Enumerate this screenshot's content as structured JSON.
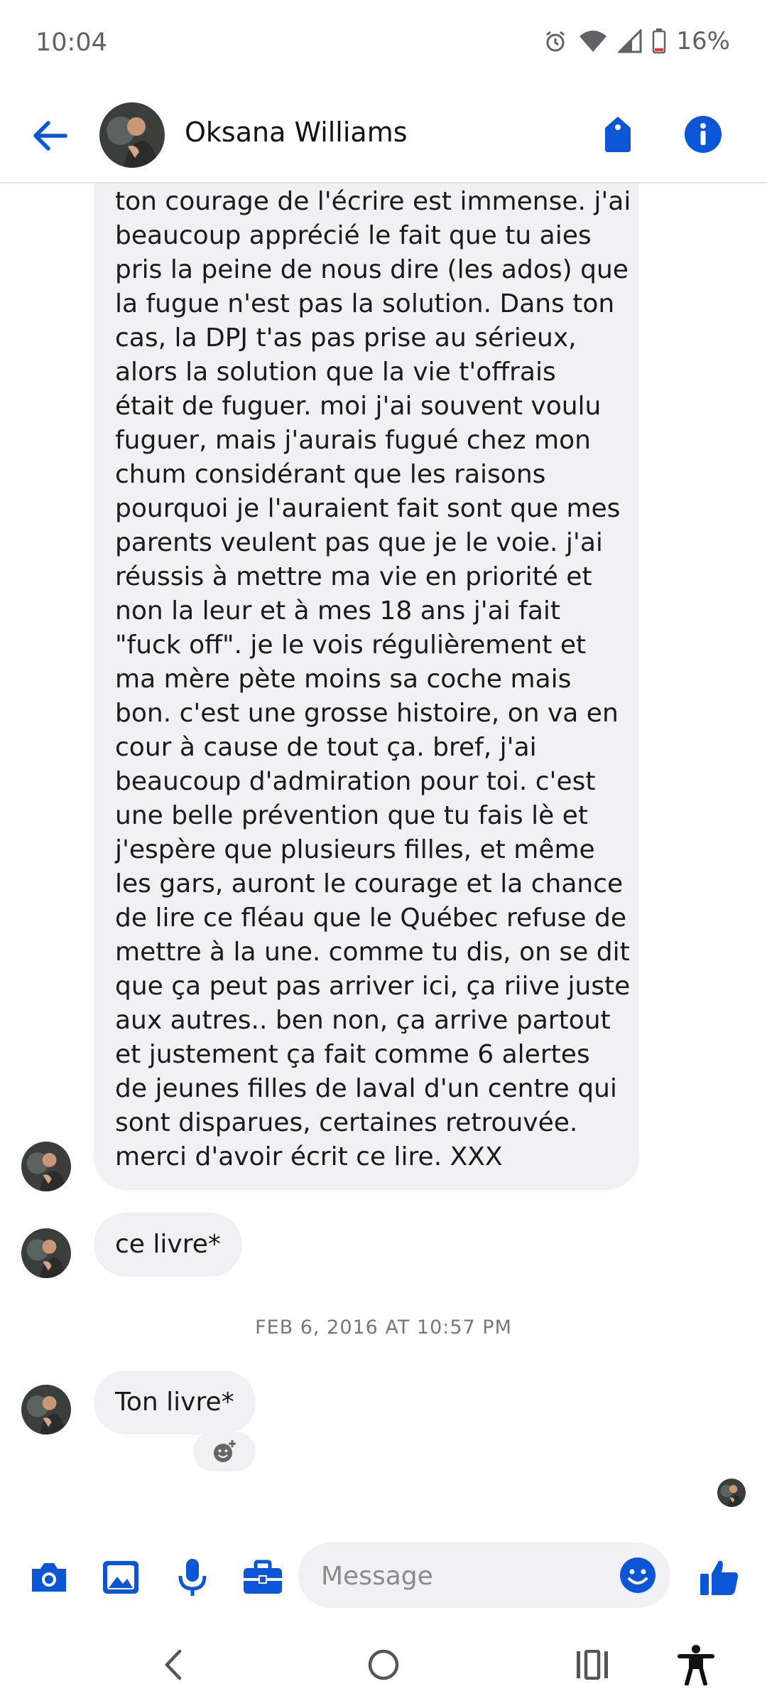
{
  "status_bar": {
    "time": "10:04",
    "battery": "16%",
    "icons": [
      "alarm-icon",
      "wifi-icon",
      "signal-icon",
      "battery-icon"
    ]
  },
  "header": {
    "contact_name": "Oksana Williams",
    "icons": [
      "back-arrow-icon",
      "tag-icon",
      "info-icon"
    ],
    "accent_color": "#0a56d6"
  },
  "messages": [
    {
      "lines": [
        "ton courage de l'écrire est immense. j'ai",
        "beaucoup apprécié le fait que tu aies",
        "pris la peine de nous dire (les ados) que",
        "la fugue n'est pas la solution. Dans ton",
        "cas, la DPJ t'as pas prise au sérieux,",
        "alors la solution que la vie t'offrais",
        "était de fuguer. moi j'ai souvent voulu",
        "fuguer, mais j'aurais fugué chez mon",
        "chum considérant que les raisons",
        "pourquoi je l'auraient fait sont que mes",
        "parents veulent pas que je le voie. j'ai",
        "réussis à mettre ma vie en priorité et",
        "non la leur et à mes 18 ans j'ai fait",
        "\"fuck off\". je le vois régulièrement et",
        "ma mère pète moins sa coche mais",
        "bon. c'est une grosse histoire, on va en",
        "cour à cause de tout ça. bref, j'ai",
        "beaucoup d'admiration pour toi. c'est",
        "une belle prévention que tu fais lè et",
        "j'espère que plusieurs filles, et même",
        "les gars, auront le courage et la chance",
        "de lire ce fléau que le Québec refuse de",
        "mettre à la une. comme tu dis, on se dit",
        "que ça peut pas arriver ici, ça riive juste",
        "aux autres.. ben non, ça arrive partout",
        "et justement ça fait comme 6 alertes",
        "de jeunes filles de laval d'un centre qui",
        "sont disparues, certaines retrouvée.",
        "merci d'avoir écrit ce lire. XXX"
      ]
    },
    {
      "text": "ce livre*"
    }
  ],
  "timestamp": "FEB 6, 2016 AT 10:57 PM",
  "last_message": {
    "text": "Ton livre*",
    "reaction_icon": "add-reaction-icon"
  },
  "composer": {
    "placeholder": "Message",
    "icons": [
      "camera-icon",
      "gallery-icon",
      "microphone-icon",
      "briefcase-icon",
      "emoji-icon",
      "thumbs-up-icon"
    ]
  },
  "nav_bar": {
    "icons": [
      "nav-back-icon",
      "home-icon",
      "recents-icon",
      "accessibility-icon"
    ]
  }
}
